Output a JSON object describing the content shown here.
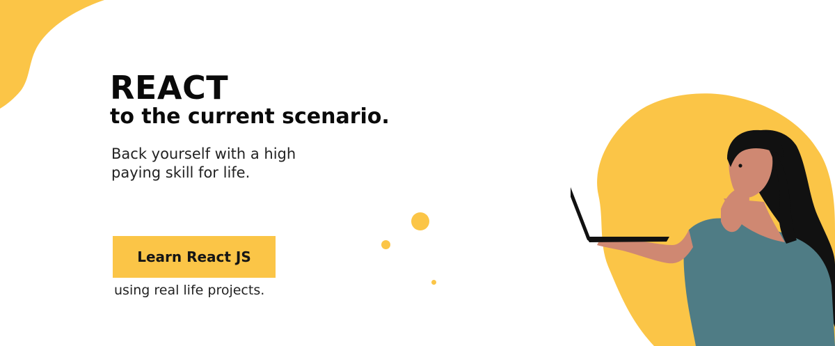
{
  "headline": {
    "title": "REACT",
    "subtitle": "to the current scenario."
  },
  "tagline": {
    "line1": "Back yourself with a high",
    "line2": "paying skill for life."
  },
  "cta": {
    "label": "Learn React JS",
    "caption": "using real life projects."
  },
  "colors": {
    "accent": "#fbc547",
    "shirt": "#4f7c85",
    "skin": "#cf8872",
    "hair": "#111111"
  }
}
